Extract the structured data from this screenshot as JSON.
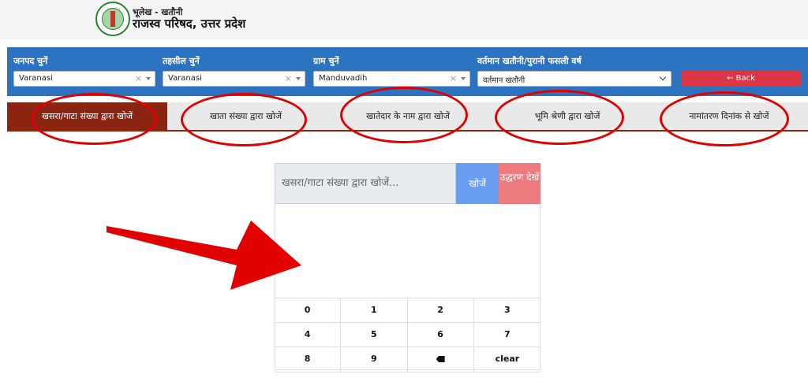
{
  "header": {
    "subtitle": "भूलेख - खतौनी",
    "title": "राजस्व परिषद, उत्तर प्रदेश"
  },
  "filters": {
    "district": {
      "label": "जनपद चुनें",
      "value": "Varanasi"
    },
    "tehsil": {
      "label": "तहसील चुनें",
      "value": "Varanasi"
    },
    "village": {
      "label": "ग्राम चुनें",
      "value": "Manduvadih"
    },
    "year": {
      "label": "वर्तमान खतौनी/पुरानी फसली वर्ष",
      "value": "वर्तमान खतौनी"
    },
    "back_label": "← Back"
  },
  "tabs": [
    {
      "label": "खसरा/गाटा संख्या द्वारा खोजें",
      "active": true
    },
    {
      "label": "खाता संख्या द्वारा खोजें",
      "active": false
    },
    {
      "label": "खातेदार के नाम द्वारा खोजें",
      "active": false
    },
    {
      "label": "भूमि श्रेणी द्वारा खोजें",
      "active": false
    },
    {
      "label": "नामांतरण दिनांक से खोजें",
      "active": false
    }
  ],
  "search": {
    "placeholder": "खसरा/गाटा संख्या द्वारा खोजें...",
    "search_label": "खोजें",
    "view_label": "उद्धरण देखें"
  },
  "keypad": [
    "0",
    "1",
    "2",
    "3",
    "4",
    "5",
    "6",
    "7",
    "8",
    "9",
    "backspace",
    "clear"
  ],
  "colors": {
    "filter_bar": "#2b72c0",
    "active_tab": "#8b2512",
    "back_button": "#dc3545",
    "search_button": "#6a9ef0",
    "view_button": "#ec7a7f",
    "annotation_red": "#e00000"
  }
}
